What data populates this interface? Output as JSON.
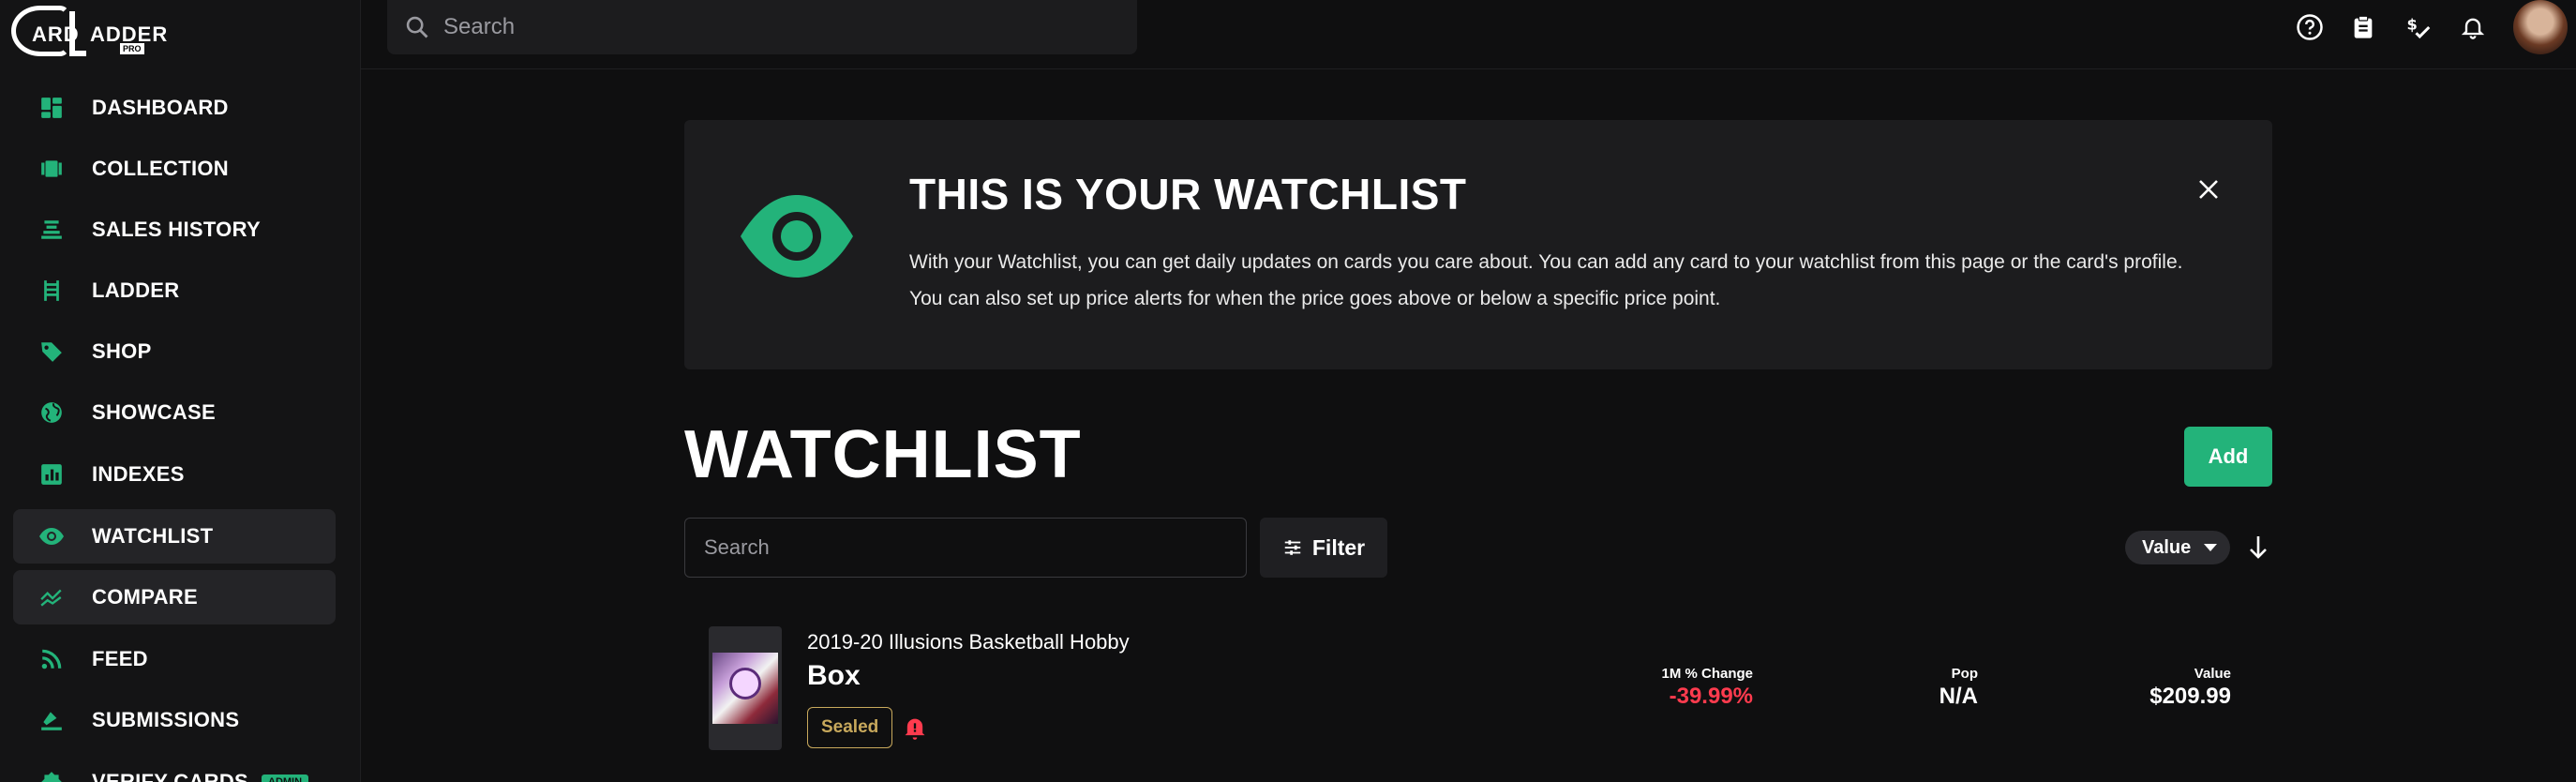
{
  "app": {
    "logo_text_1": "ARD",
    "logo_text_2": "ADDER",
    "logo_badge": "PRO"
  },
  "colors": {
    "accent": "#23b37a",
    "negative": "#ff3b4e",
    "sealed": "#c8a95c",
    "background": "#0f0f10",
    "panel": "#1c1c1e"
  },
  "sidebar": {
    "items": [
      {
        "label": "DASHBOARD",
        "icon": "dashboard-icon"
      },
      {
        "label": "COLLECTION",
        "icon": "collection-icon"
      },
      {
        "label": "SALES HISTORY",
        "icon": "sales-history-icon"
      },
      {
        "label": "LADDER",
        "icon": "ladder-icon"
      },
      {
        "label": "SHOP",
        "icon": "tag-icon"
      },
      {
        "label": "SHOWCASE",
        "icon": "globe-icon"
      },
      {
        "label": "INDEXES",
        "icon": "chart-icon"
      },
      {
        "label": "WATCHLIST",
        "icon": "eye-icon",
        "active": true
      },
      {
        "label": "COMPARE",
        "icon": "compare-icon"
      },
      {
        "label": "FEED",
        "icon": "rss-icon"
      },
      {
        "label": "SUBMISSIONS",
        "icon": "submissions-icon"
      },
      {
        "label": "VERIFY CARDS",
        "icon": "verify-icon",
        "badge": "ADMIN"
      }
    ]
  },
  "topbar": {
    "search_placeholder": "Search",
    "icons": [
      "help-icon",
      "clipboard-icon",
      "price-check-icon",
      "bell-icon",
      "avatar"
    ]
  },
  "banner": {
    "title": "THIS IS YOUR WATCHLIST",
    "body": "With your Watchlist, you can get daily updates on cards you care about. You can add any card to your watchlist from this page or the card's profile. You can also set up price alerts for when the price goes above or below a specific price point."
  },
  "watchlist": {
    "title": "WATCHLIST",
    "add_label": "Add",
    "search_placeholder": "Search",
    "filter_label": "Filter",
    "sort_value": "Value"
  },
  "cards": [
    {
      "name_line1": "2019-20 Illusions Basketball Hobby",
      "name_line2": "Box",
      "badge": "Sealed",
      "change_label": "1M % Change",
      "change_value": "-39.99%",
      "pop_label": "Pop",
      "pop_value": "N/A",
      "value_label": "Value",
      "value_value": "$209.99"
    }
  ]
}
